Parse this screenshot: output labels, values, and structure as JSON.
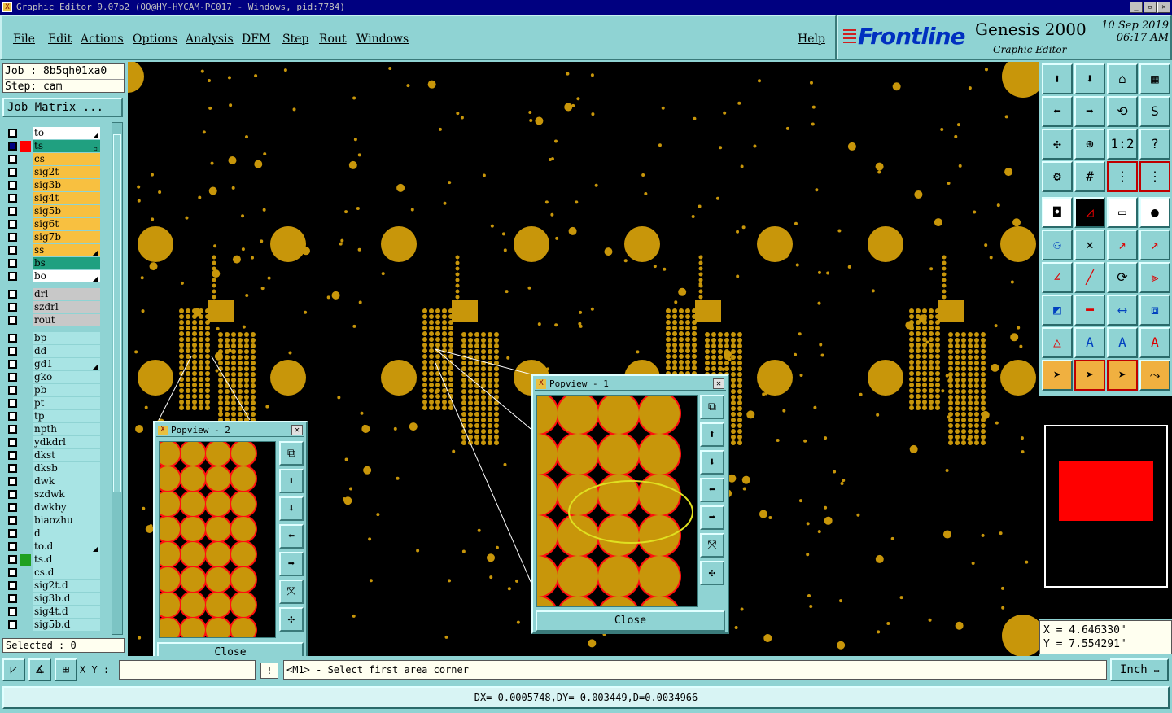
{
  "window": {
    "title": "Graphic Editor 9.07b2 (OO@HY-HYCAM-PC017 - Windows, pid:7784)"
  },
  "menu": {
    "file": "File",
    "edit": "Edit",
    "actions": "Actions",
    "options": "Options",
    "analysis": "Analysis",
    "dfm": "DFM",
    "step": "Step",
    "rout": "Rout",
    "windows": "Windows",
    "help": "Help"
  },
  "brand": {
    "logo": "Frontline",
    "product": "Genesis 2000",
    "subtitle": "Graphic Editor",
    "date": "10 Sep 2019",
    "time": "06:17 AM"
  },
  "job": {
    "job_line": "Job : 8b5qh01xa0",
    "step_line": "Step: cam",
    "matrix_button": "Job Matrix ..."
  },
  "layers": [
    {
      "name": "to",
      "color": "#ffffff",
      "swatch": "",
      "mark": "◢"
    },
    {
      "name": "ts",
      "color": "#20a080",
      "swatch": "#ff0000",
      "mark": "▫"
    },
    {
      "name": "cs",
      "color": "#f8c040",
      "swatch": "",
      "mark": ""
    },
    {
      "name": "sig2t",
      "color": "#f8c040",
      "swatch": "",
      "mark": ""
    },
    {
      "name": "sig3b",
      "color": "#f8c040",
      "swatch": "",
      "mark": ""
    },
    {
      "name": "sig4t",
      "color": "#f8c040",
      "swatch": "",
      "mark": ""
    },
    {
      "name": "sig5b",
      "color": "#f8c040",
      "swatch": "",
      "mark": ""
    },
    {
      "name": "sig6t",
      "color": "#f8c040",
      "swatch": "",
      "mark": ""
    },
    {
      "name": "sig7b",
      "color": "#f8c040",
      "swatch": "",
      "mark": ""
    },
    {
      "name": "ss",
      "color": "#f8c040",
      "swatch": "",
      "mark": "◢"
    },
    {
      "name": "bs",
      "color": "#20a080",
      "swatch": "",
      "mark": ""
    },
    {
      "name": "bo",
      "color": "#ffffff",
      "swatch": "",
      "mark": "◢"
    },
    {
      "name": "",
      "color": "",
      "swatch": "",
      "mark": ""
    },
    {
      "name": "drl",
      "color": "#c8c8c8",
      "swatch": "",
      "mark": ""
    },
    {
      "name": "szdrl",
      "color": "#c8c8c8",
      "swatch": "",
      "mark": ""
    },
    {
      "name": "rout",
      "color": "#c8c8c8",
      "swatch": "",
      "mark": ""
    },
    {
      "name": "",
      "color": "",
      "swatch": "",
      "mark": ""
    },
    {
      "name": "bp",
      "color": "#a8e4e4",
      "swatch": "",
      "mark": ""
    },
    {
      "name": "dd",
      "color": "#a8e4e4",
      "swatch": "",
      "mark": ""
    },
    {
      "name": "gd1",
      "color": "#a8e4e4",
      "swatch": "",
      "mark": "◢"
    },
    {
      "name": "gko",
      "color": "#a8e4e4",
      "swatch": "",
      "mark": ""
    },
    {
      "name": "pb",
      "color": "#a8e4e4",
      "swatch": "",
      "mark": ""
    },
    {
      "name": "pt",
      "color": "#a8e4e4",
      "swatch": "",
      "mark": ""
    },
    {
      "name": "tp",
      "color": "#a8e4e4",
      "swatch": "",
      "mark": ""
    },
    {
      "name": "npth",
      "color": "#a8e4e4",
      "swatch": "",
      "mark": ""
    },
    {
      "name": "ydkdrl",
      "color": "#a8e4e4",
      "swatch": "",
      "mark": ""
    },
    {
      "name": "dkst",
      "color": "#a8e4e4",
      "swatch": "",
      "mark": ""
    },
    {
      "name": "dksb",
      "color": "#a8e4e4",
      "swatch": "",
      "mark": ""
    },
    {
      "name": "dwk",
      "color": "#a8e4e4",
      "swatch": "",
      "mark": ""
    },
    {
      "name": "szdwk",
      "color": "#a8e4e4",
      "swatch": "",
      "mark": ""
    },
    {
      "name": "dwkby",
      "color": "#a8e4e4",
      "swatch": "",
      "mark": ""
    },
    {
      "name": "biaozhu",
      "color": "#a8e4e4",
      "swatch": "",
      "mark": ""
    },
    {
      "name": "d",
      "color": "#a8e4e4",
      "swatch": "",
      "mark": ""
    },
    {
      "name": "to.d",
      "color": "#a8e4e4",
      "swatch": "",
      "mark": "◢"
    },
    {
      "name": "ts.d",
      "color": "#a8e4e4",
      "swatch": "#20a020",
      "mark": ""
    },
    {
      "name": "cs.d",
      "color": "#a8e4e4",
      "swatch": "",
      "mark": ""
    },
    {
      "name": "sig2t.d",
      "color": "#a8e4e4",
      "swatch": "",
      "mark": ""
    },
    {
      "name": "sig3b.d",
      "color": "#a8e4e4",
      "swatch": "",
      "mark": ""
    },
    {
      "name": "sig4t.d",
      "color": "#a8e4e4",
      "swatch": "",
      "mark": ""
    },
    {
      "name": "sig5b.d",
      "color": "#a8e4e4",
      "swatch": "",
      "mark": ""
    }
  ],
  "selected": "Selected : 0",
  "popview1": {
    "title": "Popview - 1",
    "close": "Close"
  },
  "popview2": {
    "title": "Popview - 2",
    "close": "Close"
  },
  "coords": {
    "x": "X = 4.646330\"",
    "y": "Y = 7.554291\""
  },
  "bottom": {
    "xy_label": "X Y :",
    "xy_value": "",
    "bang": "!",
    "prompt": "<M1> - Select first area corner",
    "unit": "Inch"
  },
  "status": "DX=-0.0005748,DY=-0.003449,D=0.0034966",
  "colors": {
    "pad": "#c8960a",
    "clearance": "#ff1010",
    "highlight": "#e0e020",
    "background": "#000000"
  }
}
